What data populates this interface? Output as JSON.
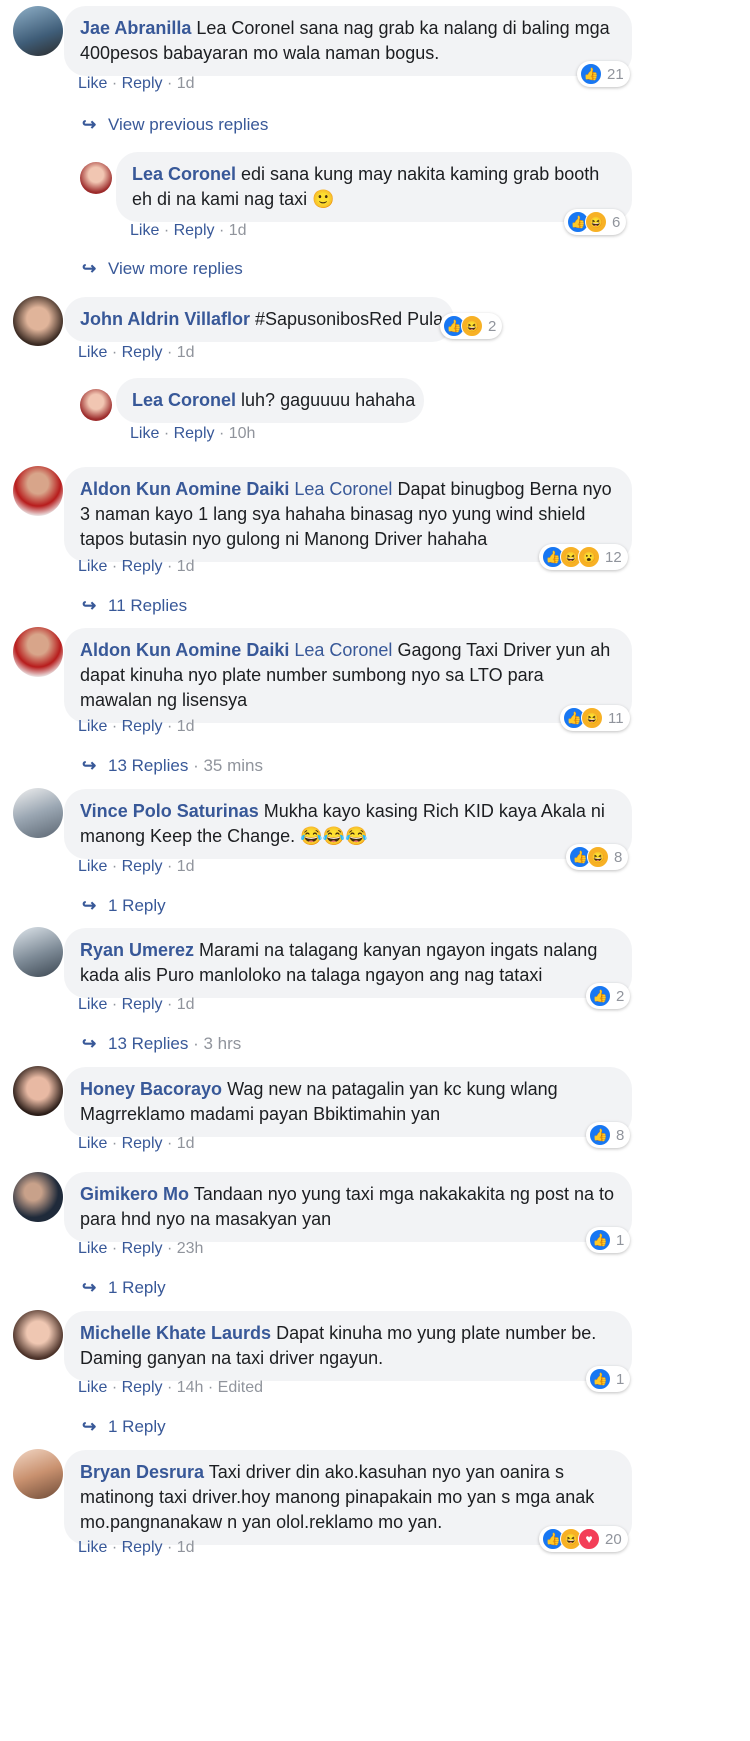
{
  "actions": {
    "like": "Like",
    "reply": "Reply",
    "dot": "·",
    "edited": "Edited"
  },
  "comments": [
    {
      "name": "Jae Abranilla",
      "mention": "",
      "text": " Lea Coronel sana nag grab ka nalang di baling mga 400pesos babayaran mo wala naman bogus.",
      "time": "1d",
      "reactions": {
        "icons": [
          "like-icon"
        ],
        "count": "21"
      }
    },
    {
      "name": "Lea Coronel",
      "mention": "",
      "text": " edi sana kung may nakita kaming grab booth eh di na kami nag taxi ",
      "emoji": "🙂",
      "time": "1d",
      "reactions": {
        "icons": [
          "like-icon",
          "haha-icon"
        ],
        "count": "6"
      }
    },
    {
      "name": "John Aldrin Villaflor",
      "mention": "",
      "text": " #SapusonibosRed Pula",
      "time": "1d",
      "reactions": {
        "icons": [
          "like-icon",
          "haha-icon"
        ],
        "count": "2"
      }
    },
    {
      "name": "Lea Coronel",
      "mention": "",
      "text": " luh? gaguuuu hahaha",
      "time": "10h"
    },
    {
      "name": "Aldon Kun Aomine Daiki",
      "mention": "Lea Coronel",
      "text": " Dapat binugbog Berna nyo 3 naman kayo 1 lang sya hahaha binasag nyo yung wind shield tapos butasin nyo gulong ni Manong Driver hahaha",
      "time": "1d",
      "reactions": {
        "icons": [
          "like-icon",
          "haha-icon",
          "wow-icon"
        ],
        "count": "12"
      }
    },
    {
      "name": "Aldon Kun Aomine Daiki",
      "mention": "Lea Coronel",
      "text": " Gagong Taxi Driver yun ah dapat kinuha nyo plate number sumbong nyo sa LTO para mawalan ng lisensya",
      "time": "1d",
      "reactions": {
        "icons": [
          "like-icon",
          "haha-icon"
        ],
        "count": "11"
      }
    },
    {
      "name": "Vince Polo Saturinas",
      "mention": "",
      "text": " Mukha kayo kasing Rich KID kaya Akala ni manong Keep the Change. ",
      "emoji": "😂😂😂",
      "time": "1d",
      "reactions": {
        "icons": [
          "like-icon",
          "haha-icon"
        ],
        "count": "8"
      }
    },
    {
      "name": "Ryan Umerez",
      "mention": "",
      "text": " Marami na talagang kanyan ngayon ingats nalang kada alis Puro manloloko na talaga ngayon ang nag tataxi",
      "time": "1d",
      "reactions": {
        "icons": [
          "like-icon"
        ],
        "count": "2"
      }
    },
    {
      "name": "Honey Bacorayo",
      "mention": "",
      "text": " Wag new na patagalin yan kc kung wlang Magrreklamo madami payan Bbiktimahin yan",
      "time": "1d",
      "reactions": {
        "icons": [
          "like-icon"
        ],
        "count": "8"
      }
    },
    {
      "name": "Gimikero Mo",
      "mention": "",
      "text": " Tandaan nyo yung taxi mga nakakakita ng post na to para hnd nyo na masakyan yan",
      "time": "23h",
      "reactions": {
        "icons": [
          "like-icon"
        ],
        "count": "1"
      }
    },
    {
      "name": "Michelle Khate Laurds",
      "mention": "",
      "text": " Dapat kinuha mo yung plate number be. Daming ganyan na taxi driver ngayun.",
      "time": "14h",
      "edited": true,
      "reactions": {
        "icons": [
          "like-icon"
        ],
        "count": "1"
      }
    },
    {
      "name": "Bryan Desrura",
      "mention": "",
      "text": " Taxi driver din ako.kasuhan nyo yan oanira s matinong taxi driver.hoy manong pinapakain mo yan s mga anak mo.pangnanakaw n yan olol.reklamo mo yan.",
      "time": "1d",
      "reactions": {
        "icons": [
          "like-icon",
          "haha-icon",
          "love-icon"
        ],
        "count": "20"
      }
    }
  ],
  "reply_links": [
    {
      "label": "View previous replies",
      "time": ""
    },
    {
      "label": "View more replies",
      "time": ""
    },
    {
      "label": "11 Replies",
      "time": ""
    },
    {
      "label": "13 Replies",
      "time": "35 mins"
    },
    {
      "label": "1 Reply",
      "time": ""
    },
    {
      "label": "13 Replies",
      "time": "3 hrs"
    },
    {
      "label": "1 Reply",
      "time": ""
    },
    {
      "label": "1 Reply",
      "time": ""
    }
  ],
  "colors": {
    "link": "#385898",
    "bubble": "#f2f3f5",
    "muted": "#90949c",
    "like": "#1877f2",
    "haha": "#f7b125",
    "love": "#f33e58"
  }
}
